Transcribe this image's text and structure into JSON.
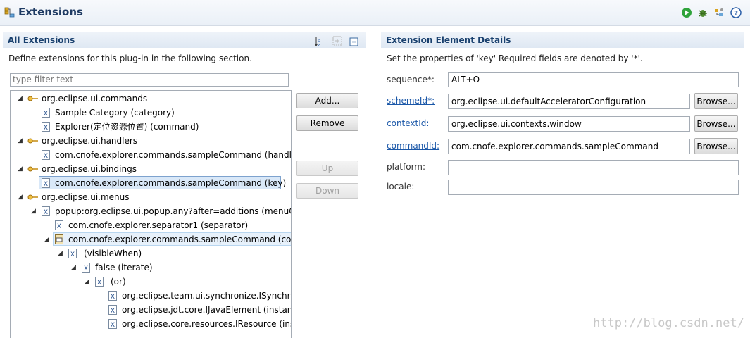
{
  "header": {
    "title": "Extensions"
  },
  "all_extensions": {
    "title": "All Extensions",
    "description": "Define extensions for this plug-in in the following section.",
    "filter_placeholder": "type filter text",
    "tree": [
      {
        "label": "org.eclipse.ui.commands",
        "icon": "extension-point-icon",
        "expanded": true
      },
      {
        "label": "Sample Category (category)",
        "icon": "element-icon"
      },
      {
        "label": "Explorer(定位资源位置) (command)",
        "icon": "element-icon"
      },
      {
        "label": "org.eclipse.ui.handlers",
        "icon": "extension-point-icon",
        "expanded": true
      },
      {
        "label": "com.cnofe.explorer.commands.sampleCommand (handler",
        "icon": "element-icon"
      },
      {
        "label": "org.eclipse.ui.bindings",
        "icon": "extension-point-icon",
        "expanded": true
      },
      {
        "label": "com.cnofe.explorer.commands.sampleCommand (key)",
        "icon": "element-icon",
        "selected": true
      },
      {
        "label": "org.eclipse.ui.menus",
        "icon": "extension-point-icon",
        "expanded": true
      },
      {
        "label": "popup:org.eclipse.ui.popup.any?after=additions (menuCo",
        "icon": "element-icon",
        "expanded": true
      },
      {
        "label": "com.cnofe.explorer.separator1 (separator)",
        "icon": "element-icon"
      },
      {
        "label": "com.cnofe.explorer.commands.sampleCommand (com",
        "icon": "command-element-icon",
        "expanded": true,
        "hover": true
      },
      {
        "label": "(visibleWhen)",
        "icon": "element-icon",
        "expanded": true
      },
      {
        "label": "false (iterate)",
        "icon": "element-icon",
        "expanded": true
      },
      {
        "label": "(or)",
        "icon": "element-icon",
        "expanded": true
      },
      {
        "label": "org.eclipse.team.ui.synchronize.ISynchror",
        "icon": "element-icon"
      },
      {
        "label": "org.eclipse.jdt.core.IJavaElement (instanc",
        "icon": "element-icon"
      },
      {
        "label": "org.eclipse.core.resources.IResource (ins",
        "icon": "element-icon"
      }
    ],
    "buttons": {
      "add": "Add...",
      "remove": "Remove",
      "up": "Up",
      "down": "Down"
    }
  },
  "details": {
    "title": "Extension Element Details",
    "description": "Set the properties of 'key' Required fields are denoted by '*'.",
    "fields": [
      {
        "label": "sequence*:",
        "value": "ALT+O",
        "link": false,
        "browse": ""
      },
      {
        "label": "schemeId*:",
        "value": "org.eclipse.ui.defaultAcceleratorConfiguration",
        "link": true,
        "browse": "Browse..."
      },
      {
        "label": "contextId:",
        "value": "org.eclipse.ui.contexts.window",
        "link": true,
        "browse": "Browse..."
      },
      {
        "label": "commandId:",
        "value": "com.cnofe.explorer.commands.sampleCommand",
        "link": true,
        "browse": "Browse..."
      },
      {
        "label": "platform:",
        "value": "",
        "link": false,
        "browse": ""
      },
      {
        "label": "locale:",
        "value": "",
        "link": false,
        "browse": ""
      }
    ]
  },
  "watermark": "http://blog.csdn.net/",
  "colors": {
    "section_title": "#19406e",
    "link": "#1a57a8",
    "selection": "#d9e8f8"
  }
}
